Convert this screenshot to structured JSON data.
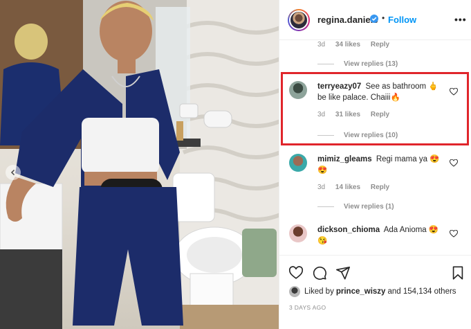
{
  "header": {
    "username": "regina.daniels",
    "separator": "•",
    "follow_label": "Follow",
    "more_label": "•••"
  },
  "top_comment_meta": {
    "time": "3d",
    "likes": "34 likes",
    "reply": "Reply",
    "view_replies": "View replies (13)"
  },
  "comments": [
    {
      "username": "terryeazy07",
      "text": "See as bathroom 🖕 be like palace. Chaiii🔥",
      "time": "3d",
      "likes": "31 likes",
      "reply": "Reply",
      "view_replies": "View replies (10)"
    },
    {
      "username": "mimiz_gleams",
      "text": "Regi mama ya 😍 😍",
      "time": "3d",
      "likes": "14 likes",
      "reply": "Reply",
      "view_replies": "View replies (1)"
    },
    {
      "username": "dickson_chioma",
      "text": "Ada Anioma 😍 😘"
    }
  ],
  "footer": {
    "liked_by_prefix": "Liked by",
    "liked_by_user": "prince_wiszy",
    "liked_by_suffix": "and 154,134 others",
    "timestamp": "3 DAYS AGO"
  },
  "colors": {
    "link_blue": "#0095f6",
    "highlight_red": "#e0252b",
    "muted_text": "#8e8e8e"
  },
  "icons": [
    "verified-badge-icon",
    "heart-icon",
    "comment-icon",
    "share-icon",
    "bookmark-icon",
    "chevron-left-icon"
  ]
}
